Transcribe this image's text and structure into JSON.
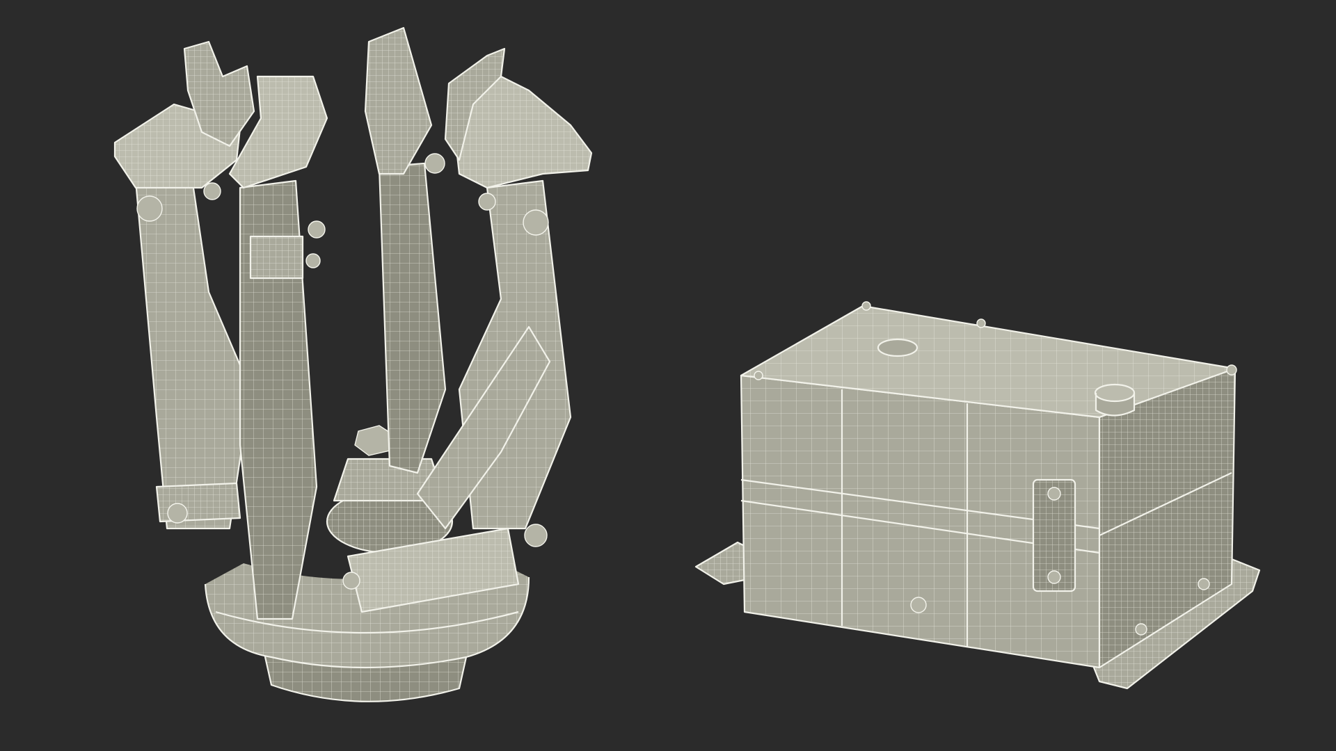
{
  "scene": {
    "background_color": "#2b2b2b",
    "model_fill_color": "#a9a99b",
    "wireframe_color": "#f2f2ea",
    "objects": [
      {
        "name": "robotic-gripper",
        "render_style": "wireframe-over-shaded",
        "fingers": 6
      },
      {
        "name": "control-box",
        "render_style": "wireframe-over-shaded",
        "mounting_brackets": 2
      }
    ]
  }
}
